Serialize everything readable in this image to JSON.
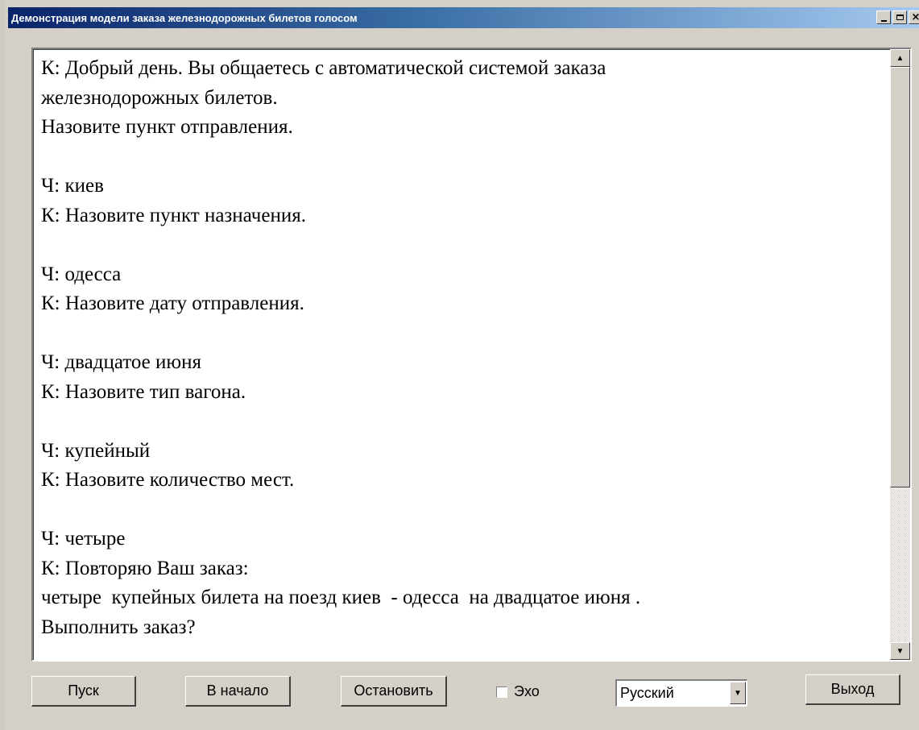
{
  "window": {
    "title": "Демонстрация модели заказа железнодорожных билетов голосом",
    "controls": {
      "minimize": "_",
      "maximize": "□",
      "close": "×"
    }
  },
  "transcript": {
    "lines": [
      "К: Добрый день. Вы общаетесь с автоматической системой заказа",
      "железнодорожных билетов.",
      "Назовите пункт отправления.",
      "",
      "Ч: киев",
      "К: Назовите пункт назначения.",
      "",
      "Ч: одесса",
      "К: Назовите дату отправления.",
      "",
      "Ч: двадцатое июня",
      "К: Назовите тип вагона.",
      "",
      "Ч: купейный",
      "К: Назовите количество мест.",
      "",
      "Ч: четыре",
      "К: Повторяю Ваш заказ:",
      "четыре  купейных билета на поезд киев  - одесса  на двадцатое июня .",
      "Выполнить заказ?"
    ]
  },
  "buttons": {
    "start": "Пуск",
    "reset": "В начало",
    "stop": "Остановить",
    "exit": "Выход"
  },
  "echo": {
    "label": "Эхо",
    "checked": false
  },
  "language": {
    "selected": "Русский"
  },
  "scroll": {
    "up_arrow": "▲",
    "down_arrow": "▼"
  }
}
